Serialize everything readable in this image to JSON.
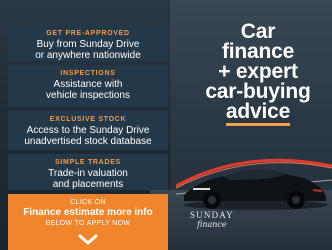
{
  "cards": [
    {
      "label": "GET PRE-APPROVED",
      "text_1": "Buy from Sunday Drive",
      "text_2": "or anywhere nationwide"
    },
    {
      "label": "INSPECTIONS",
      "text_1": "Assistance with",
      "text_2": "vehicle inspections"
    },
    {
      "label": "EXCLUSIVE STOCK",
      "text_1": "Access to the Sunday Drive",
      "text_2": "unadvertised stock database"
    },
    {
      "label": "SIMPLE TRADES",
      "text_1": "Trade-in valuation",
      "text_2": "and placements"
    }
  ],
  "cta": {
    "top": "CLICK ON",
    "main": "Finance estimate more info",
    "bottom": "BELOW TO APPLY NOW"
  },
  "headline": {
    "line_1": "Car",
    "line_2": "finance",
    "line_3": "+ expert",
    "line_4": "car-buying",
    "line_5": "advice"
  },
  "brand": {
    "line_1": "SUNDAY",
    "line_2": "finance"
  },
  "colors": {
    "accent": "#f0852b",
    "card_bg": "#233849"
  },
  "icons": {
    "chevron": "chevron-down-icon"
  }
}
